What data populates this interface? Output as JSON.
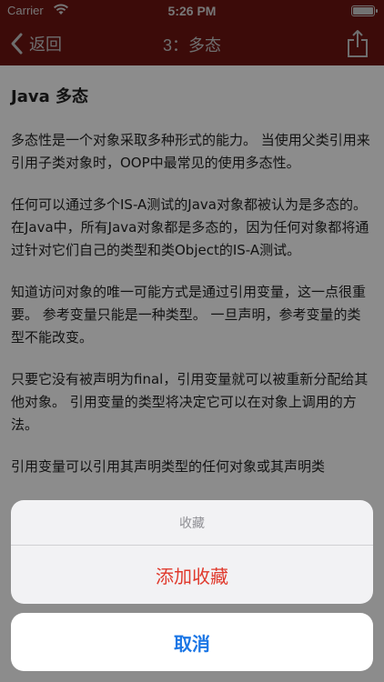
{
  "status_bar": {
    "carrier": "Carrier",
    "time": "5:26 PM"
  },
  "nav": {
    "back_label": "返回",
    "title": "3：多态"
  },
  "article": {
    "heading": "Java 多态",
    "paragraphs": [
      "多态性是一个对象采取多种形式的能力。 当使用父类引用来引用子类对象时，OOP中最常见的使用多态性。",
      "任何可以通过多个IS-A测试的Java对象都被认为是多态的。 在Java中，所有Java对象都是多态的，因为任何对象都将通过针对它们自己的类型和类Object的IS-A测试。",
      "知道访问对象的唯一可能方式是通过引用变量，这一点很重要。 参考变量只能是一种类型。 一旦声明，参考变量的类型不能改变。",
      "只要它没有被声明为final，引用变量就可以被重新分配给其他对象。 引用变量的类型将决定它可以在对象上调用的方法。",
      "引用变量可以引用其声明类型的任何对象或其声明类"
    ]
  },
  "action_sheet": {
    "title": "收藏",
    "action_label": "添加收藏",
    "cancel_label": "取消"
  },
  "colors": {
    "nav_background": "#6e1512",
    "action_red": "#e0392c",
    "cancel_blue": "#1b76e5"
  }
}
